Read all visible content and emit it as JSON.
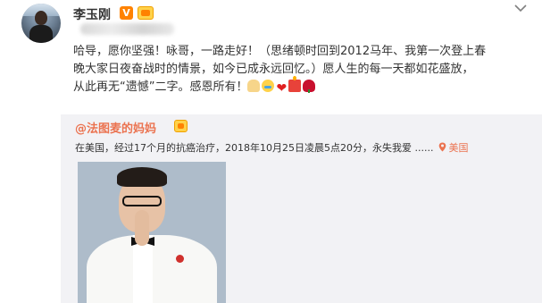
{
  "post": {
    "author_name": "李玉刚",
    "verified_badge": "V",
    "text_lines": [
      "哈导，愿你坚强！咏哥，一路走好！（思绪顿时回到2012马年、我第一次登上春",
      "晚大家日夜奋战时的情景，如今已成永远回忆。）愿人生的每一天都如花盛放，",
      "从此再无“遗憾”二字。感恩所有！"
    ],
    "trailing_emojis": [
      "pray-icon",
      "crying-icon",
      "heart-icon",
      "candle-icon",
      "rose-icon"
    ],
    "heart_glyph": "❤"
  },
  "repost": {
    "author_name": "@法图麦的妈妈",
    "text": "在美国，经过17个月的抗癌治疗，2018年10月25日凌晨5点20分，永失我爱",
    "ellipsis": "......",
    "location": "美国"
  },
  "colors": {
    "accent_orange": "#eb7350",
    "vip_orange": "#ff8200",
    "repost_bg": "#f2f2f5"
  }
}
